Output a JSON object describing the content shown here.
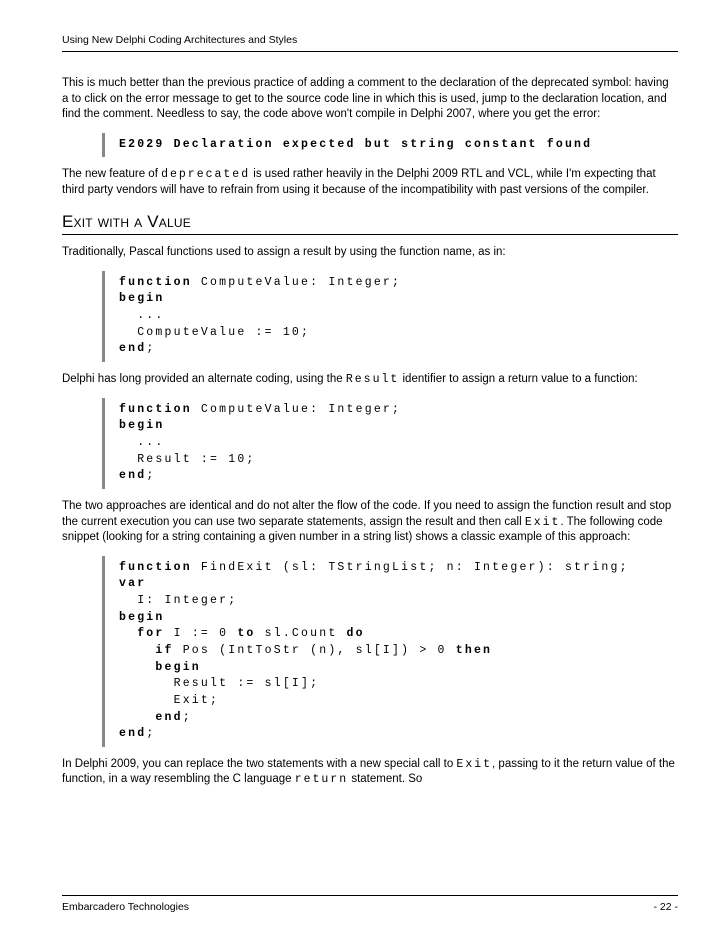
{
  "header": "Using New Delphi Coding Architectures and Styles",
  "para1a": "This is much better than the previous practice of adding a comment to the declaration of the deprecated symbol: having a to click on the error message to get to the source code line in which this is used, jump to the declaration location, and find the comment. Needless to say, the code above won't compile in Delphi 2007, where you get the error:",
  "code1": "E2029 Declaration expected but string constant found",
  "para2_a": "The new feature of ",
  "para2_code": "deprecated",
  "para2_b": " is used rather heavily in the Delphi 2009 RTL and VCL, while I'm expecting that third party vendors will have  to refrain from using it because of the incompatibility with past versions of the compiler.",
  "sectionTitle": "Exit with a Value",
  "para3": "Traditionally, Pascal functions used to assign a result by using the function name, as in:",
  "code2": {
    "l1a": "function",
    "l1b": " ComputeValue: Integer;",
    "l2": "begin",
    "l3": "  ...",
    "l4": "  ComputeValue := 10;",
    "l5a": "end",
    "l5b": ";"
  },
  "para4_a": "Delphi has long provided an alternate coding, using the ",
  "para4_code": "Result",
  "para4_b": " identifier to assign a return value to a function:",
  "code3": {
    "l1a": "function",
    "l1b": " ComputeValue: Integer;",
    "l2": "begin",
    "l3": "  ...",
    "l4": "  Result := 10;",
    "l5a": "end",
    "l5b": ";"
  },
  "para5_a": "The two approaches are identical and do not alter the flow of the code. If you need to assign the function result and stop the current execution you can use two separate statements, assign the result and then call ",
  "para5_code": "Exit",
  "para5_b": ". The following code snippet (looking for a string containing a given number in a string list) shows a classic example of this approach:",
  "code4": {
    "l1a": "function",
    "l1b": " FindExit (sl: TStringList; n: Integer): string;",
    "l2": "var",
    "l3": "  I: Integer;",
    "l4": "begin",
    "l5a": "  ",
    "l5b": "for",
    "l5c": " I := 0 ",
    "l5d": "to",
    "l5e": " sl.Count ",
    "l5f": "do",
    "l6a": "    ",
    "l6b": "if",
    "l6c": " Pos (IntToStr (n), sl[I]) > 0 ",
    "l6d": "then",
    "l7": "    begin",
    "l8": "      Result := sl[I];",
    "l9": "      Exit;",
    "l10a": "    ",
    "l10b": "end",
    "l10c": ";",
    "l11a": "end",
    "l11b": ";"
  },
  "para6_a": "In Delphi 2009, you can replace the two statements with a new special call to ",
  "para6_code1": "Exit",
  "para6_b": ",  passing to it the return value of the function, in a way resembling the C language ",
  "para6_code2": "return",
  "para6_c": " statement. So",
  "footerLeft": "Embarcadero Technologies",
  "footerRight": "- 22 -"
}
